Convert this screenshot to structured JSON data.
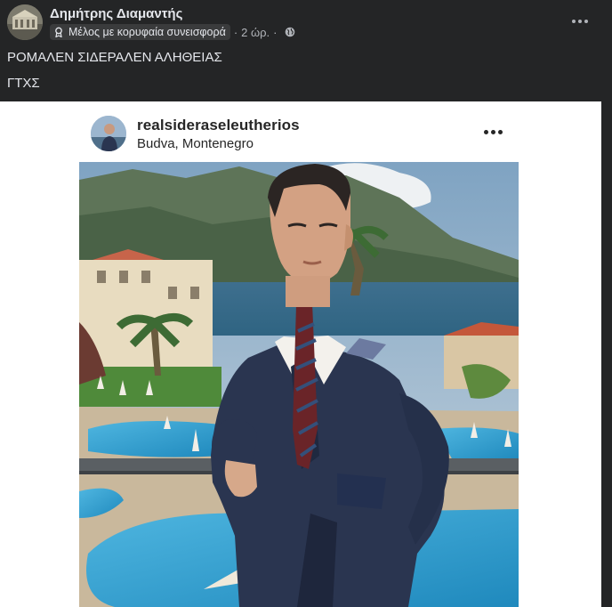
{
  "post": {
    "author_name": "Δημήτρης Διαμαντής",
    "badge_label": "Μέλος με κορυφαία συνεισφορά",
    "time": "2 ώρ.",
    "separator": "·",
    "text_line_1": "ΡΟΜΑΛΕΝ ΣΙΔΕΡΑΛΕΝ ΑΛΗΘΕΙΑΣ",
    "text_line_2": "ΓΤΧΣ",
    "icons": {
      "badge": "award-badge-icon",
      "audience": "globe-icon",
      "more": "more-options-icon"
    }
  },
  "instagram": {
    "username": "realsideraseleutherios",
    "location": "Budva, Montenegro"
  },
  "colors": {
    "background": "#242526",
    "text_primary": "#e4e6eb",
    "text_secondary": "#b0b3b8",
    "badge_bg": "#3a3b3c",
    "ig_text": "#262626",
    "suit": "#2a3550",
    "pool": "#3aa7d4"
  }
}
